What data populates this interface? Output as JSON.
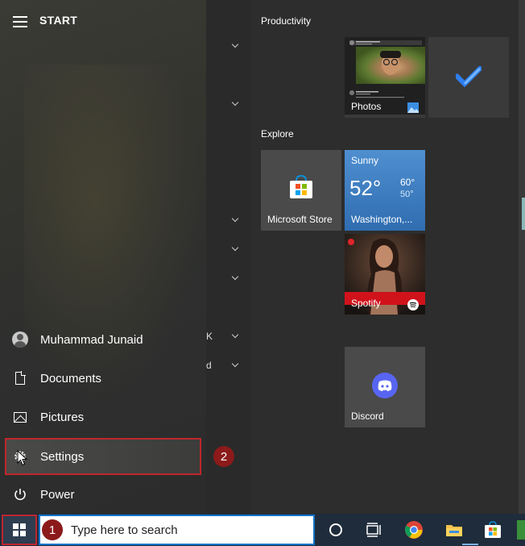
{
  "start": {
    "title": "START",
    "user": "Muhammad Junaid",
    "items": [
      {
        "label": "Documents",
        "icon": "document-icon"
      },
      {
        "label": "Pictures",
        "icon": "pictures-icon"
      },
      {
        "label": "Settings",
        "icon": "gear-icon"
      },
      {
        "label": "Power",
        "icon": "power-icon"
      }
    ],
    "applist_fragments": [
      "K",
      "d"
    ]
  },
  "groups": {
    "productivity": "Productivity",
    "explore": "Explore"
  },
  "tiles": {
    "photos": "Photos",
    "store": "Microsoft Store",
    "weather": {
      "condition": "Sunny",
      "temp": "52°",
      "high": "60°",
      "low": "50°",
      "location": "Washington,..."
    },
    "spotify": "Spotify",
    "discord": "Discord"
  },
  "annotations": {
    "step1": "1",
    "step2": "2"
  },
  "taskbar": {
    "search_placeholder": "Type here to search"
  },
  "colors": {
    "highlight": "#c0262c",
    "badge": "#8c1a1a",
    "taskbar": "#1f2c3b",
    "weather_tile": "#3f80c6",
    "discord": "#5865f2",
    "todo_check": "#2f7ff0"
  }
}
